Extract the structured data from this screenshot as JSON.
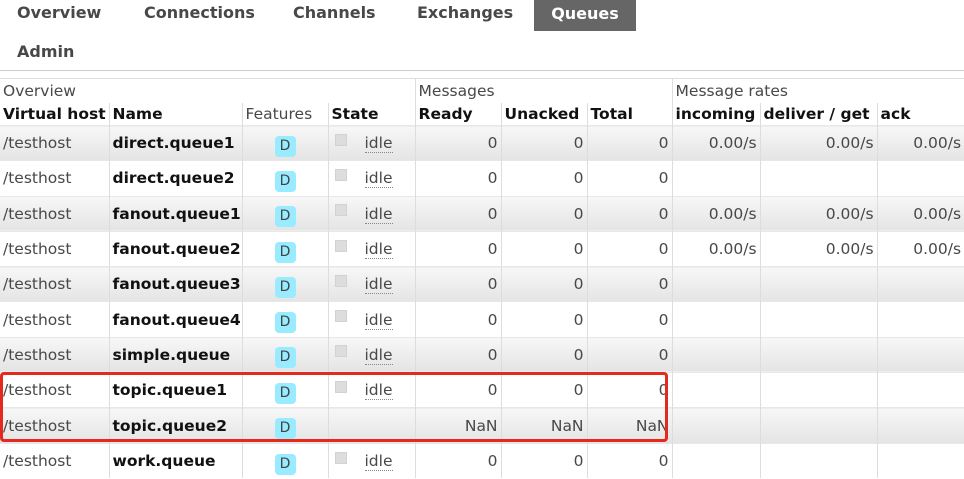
{
  "nav": {
    "items": [
      {
        "label": "Overview",
        "active": false
      },
      {
        "label": "Connections",
        "active": false
      },
      {
        "label": "Channels",
        "active": false
      },
      {
        "label": "Exchanges",
        "active": false
      },
      {
        "label": "Queues",
        "active": true
      },
      {
        "label": "Admin",
        "active": false
      }
    ]
  },
  "table": {
    "groups": [
      "Overview",
      "Messages",
      "Message rates"
    ],
    "columns": [
      "Virtual host",
      "Name",
      "Features",
      "State",
      "Ready",
      "Unacked",
      "Total",
      "incoming",
      "deliver / get",
      "ack"
    ],
    "rows": [
      {
        "vhost": "/testhost",
        "name": "direct.queue1",
        "feature": "D",
        "state": "idle",
        "ready": "0",
        "unacked": "0",
        "total": "0",
        "incoming": "0.00/s",
        "deliver": "0.00/s",
        "ack": "0.00/s"
      },
      {
        "vhost": "/testhost",
        "name": "direct.queue2",
        "feature": "D",
        "state": "idle",
        "ready": "0",
        "unacked": "0",
        "total": "0",
        "incoming": "",
        "deliver": "",
        "ack": ""
      },
      {
        "vhost": "/testhost",
        "name": "fanout.queue1",
        "feature": "D",
        "state": "idle",
        "ready": "0",
        "unacked": "0",
        "total": "0",
        "incoming": "0.00/s",
        "deliver": "0.00/s",
        "ack": "0.00/s"
      },
      {
        "vhost": "/testhost",
        "name": "fanout.queue2",
        "feature": "D",
        "state": "idle",
        "ready": "0",
        "unacked": "0",
        "total": "0",
        "incoming": "0.00/s",
        "deliver": "0.00/s",
        "ack": "0.00/s"
      },
      {
        "vhost": "/testhost",
        "name": "fanout.queue3",
        "feature": "D",
        "state": "idle",
        "ready": "0",
        "unacked": "0",
        "total": "0",
        "incoming": "",
        "deliver": "",
        "ack": ""
      },
      {
        "vhost": "/testhost",
        "name": "fanout.queue4",
        "feature": "D",
        "state": "idle",
        "ready": "0",
        "unacked": "0",
        "total": "0",
        "incoming": "",
        "deliver": "",
        "ack": ""
      },
      {
        "vhost": "/testhost",
        "name": "simple.queue",
        "feature": "D",
        "state": "idle",
        "ready": "0",
        "unacked": "0",
        "total": "0",
        "incoming": "",
        "deliver": "",
        "ack": ""
      },
      {
        "vhost": "/testhost",
        "name": "topic.queue1",
        "feature": "D",
        "state": "idle",
        "ready": "0",
        "unacked": "0",
        "total": "0",
        "incoming": "",
        "deliver": "",
        "ack": ""
      },
      {
        "vhost": "/testhost",
        "name": "topic.queue2",
        "feature": "D",
        "state": "",
        "ready": "NaN",
        "unacked": "NaN",
        "total": "NaN",
        "incoming": "",
        "deliver": "",
        "ack": ""
      },
      {
        "vhost": "/testhost",
        "name": "work.queue",
        "feature": "D",
        "state": "idle",
        "ready": "0",
        "unacked": "0",
        "total": "0",
        "incoming": "",
        "deliver": "",
        "ack": ""
      }
    ]
  },
  "colors": {
    "active_tab": "#666666",
    "badge": "#99ebff",
    "highlight": "#e5291c"
  }
}
